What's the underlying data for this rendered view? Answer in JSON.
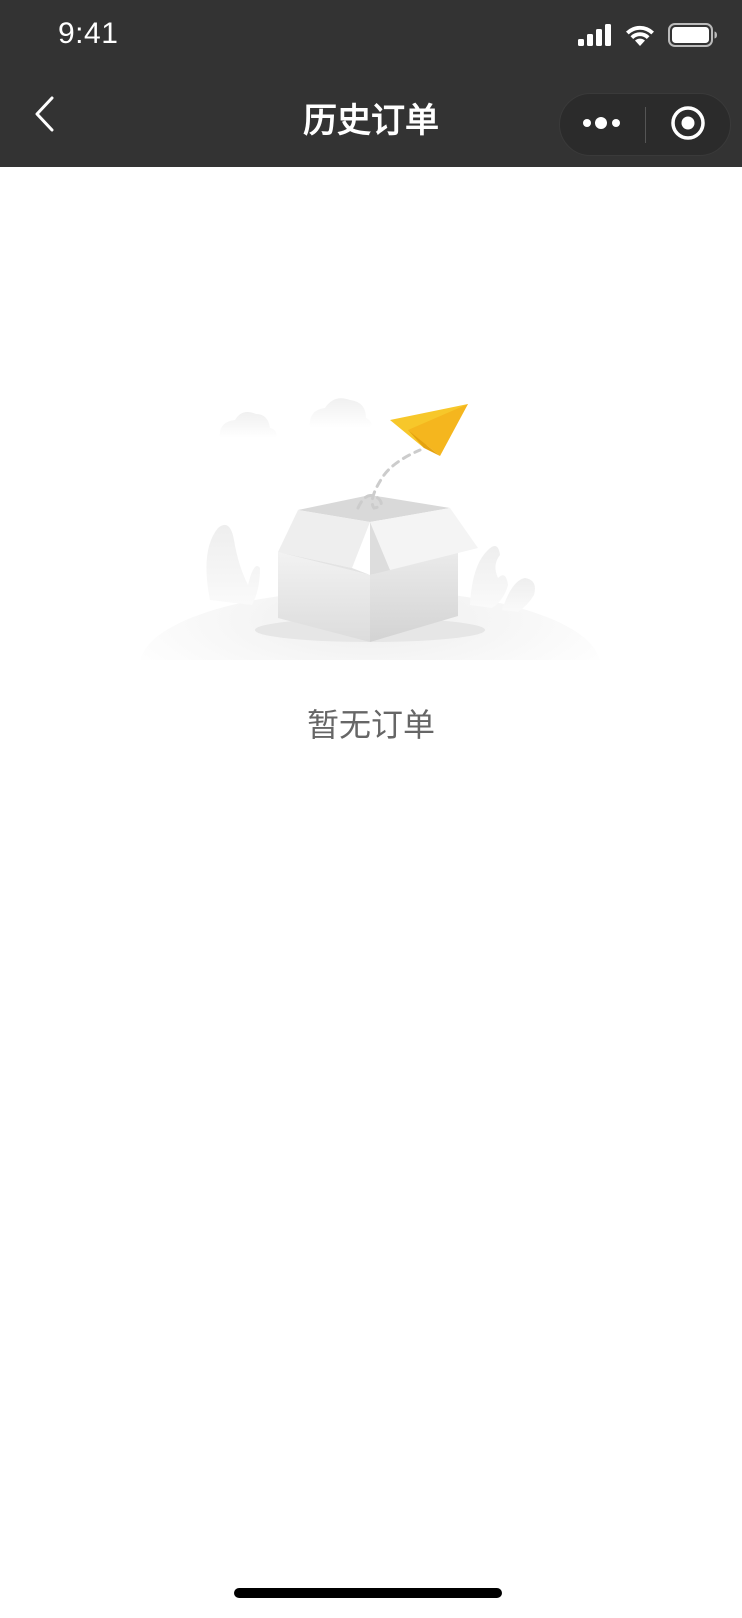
{
  "status_bar": {
    "time": "9:41",
    "icons": [
      "signal-icon",
      "wifi-icon",
      "battery-icon"
    ]
  },
  "nav": {
    "title": "历史订单",
    "back_icon": "chevron-left-icon",
    "more_icon": "more-dots-icon",
    "close_icon": "mini-program-close-icon"
  },
  "empty_state": {
    "illustration": "empty-box-paper-plane-illustration",
    "message": "暂无订单"
  },
  "colors": {
    "nav_background": "#333333",
    "page_background": "#ffffff",
    "empty_text": "#666666",
    "accent_plane": "#f7c72a"
  }
}
